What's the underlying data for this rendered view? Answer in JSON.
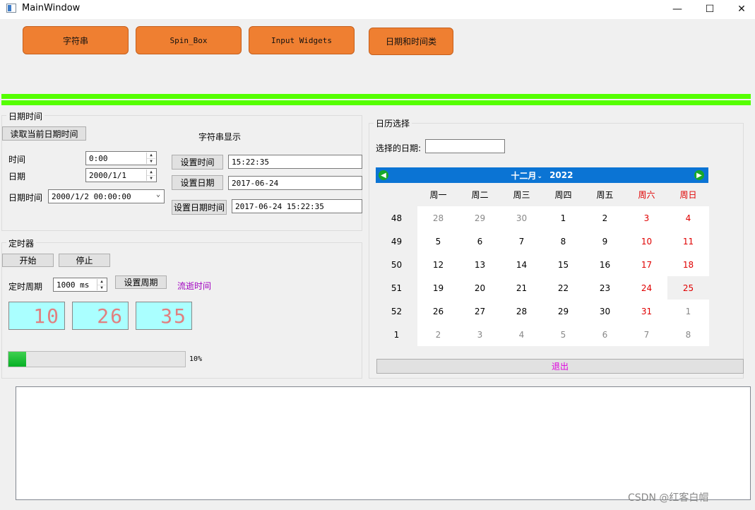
{
  "window": {
    "title": "MainWindow",
    "minimize": "—",
    "maximize": "☐",
    "close": "✕"
  },
  "tabs": [
    {
      "label": "字符串"
    },
    {
      "label": "Spin_Box"
    },
    {
      "label": "Input Widgets"
    },
    {
      "label": "日期和时间类"
    }
  ],
  "progress_top_color": "#55ff00",
  "datetime_group": {
    "title": "日期时间",
    "read_button": "读取当前日期时间",
    "string_display_label": "字符串显示",
    "time_label": "时间",
    "time_value": "0:00",
    "date_label": "日期",
    "date_value": "2000/1/1",
    "datetime_label": "日期时间",
    "datetime_value": "2000/1/2 00:00:00",
    "set_time_button": "设置时间",
    "set_time_value": "15:22:35",
    "set_date_button": "设置日期",
    "set_date_value": "2017-06-24",
    "set_datetime_button": "设置日期时间",
    "set_datetime_value": "2017-06-24 15:22:35"
  },
  "timer_group": {
    "title": "定时器",
    "start_button": "开始",
    "stop_button": "停止",
    "period_label": "定时周期",
    "period_value": "1000 ms",
    "set_period_button": "设置周期",
    "elapsed_label": "流逝时间",
    "lcd_hour": "10",
    "lcd_minute": "26",
    "lcd_second": "35",
    "progress_percent": 10,
    "progress_text": "10%"
  },
  "calendar_group": {
    "title": "日历选择",
    "selected_label": "选择的日期:",
    "selected_value": "",
    "month": "十二月",
    "year": "2022",
    "weekdays": [
      "周一",
      "周二",
      "周三",
      "周四",
      "周五",
      "周六",
      "周日"
    ],
    "weeks": [
      "48",
      "49",
      "50",
      "51",
      "52",
      "1"
    ],
    "days": [
      [
        "28",
        "29",
        "30",
        "1",
        "2",
        "3",
        "4"
      ],
      [
        "5",
        "6",
        "7",
        "8",
        "9",
        "10",
        "11"
      ],
      [
        "12",
        "13",
        "14",
        "15",
        "16",
        "17",
        "18"
      ],
      [
        "19",
        "20",
        "21",
        "22",
        "23",
        "24",
        "25"
      ],
      [
        "26",
        "27",
        "28",
        "29",
        "30",
        "31",
        "1"
      ],
      [
        "2",
        "3",
        "4",
        "5",
        "6",
        "7",
        "8"
      ]
    ],
    "exit_button": "退出"
  },
  "colors": {
    "weekend": "#e00000",
    "other_month": "#888888",
    "exit_text": "#e000e0",
    "elapsed_text": "#a000c0"
  },
  "watermark": "CSDN @红客白帽"
}
